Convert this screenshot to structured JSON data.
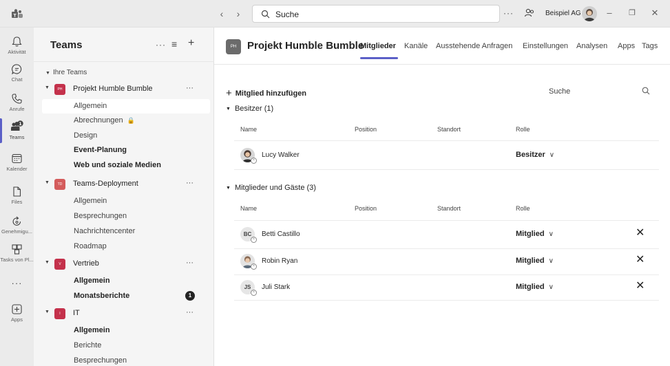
{
  "topbar": {
    "search_text": "Suche",
    "more_label": "···",
    "org_name": "Beispiel AG",
    "minimize": "–",
    "restore": "❐",
    "close": "✕",
    "back": "‹",
    "forward": "›"
  },
  "rail": {
    "items": [
      {
        "label": "Aktivität",
        "icon": "bell-icon"
      },
      {
        "label": "Chat",
        "icon": "chat-icon"
      },
      {
        "label": "Anrufe",
        "icon": "phone-icon"
      },
      {
        "label": "Teams",
        "icon": "teams-icon",
        "badge": "1"
      },
      {
        "label": "Kalender",
        "icon": "calendar-icon"
      },
      {
        "label": "Files",
        "icon": "file-icon"
      },
      {
        "label": "Genehmigu...",
        "icon": "approvals-icon"
      },
      {
        "label": "Tasks von Pl...",
        "icon": "tasks-icon"
      },
      {
        "label": "",
        "icon": "more-icon",
        "glyph": "···"
      },
      {
        "label": "Apps",
        "icon": "apps-icon"
      }
    ],
    "accent": "#5b5fc7"
  },
  "panel": {
    "title": "Teams",
    "more": "···",
    "filter": "≡",
    "add": "+",
    "section_label": "Ihre Teams",
    "teams": [
      {
        "name": "Projekt Humble Bumble",
        "initials": "PH",
        "color": "#c4314b",
        "more": "···",
        "channels": [
          {
            "name": "Allgemein",
            "bold": false,
            "selected": true
          },
          {
            "name": "Abrechnungen",
            "bold": false,
            "locked": true
          },
          {
            "name": "Design",
            "bold": false
          },
          {
            "name": "Event-Planung",
            "bold": true
          },
          {
            "name": "Web und soziale Medien",
            "bold": true
          }
        ]
      },
      {
        "name": "Teams-Deployment",
        "initials": "TD",
        "color": "#d45c5c",
        "more": "···",
        "channels": [
          {
            "name": "Allgemein",
            "bold": false
          },
          {
            "name": "Besprechungen",
            "bold": false
          },
          {
            "name": "Nachrichtencenter",
            "bold": false
          },
          {
            "name": "Roadmap",
            "bold": false
          }
        ]
      },
      {
        "name": "Vertrieb",
        "initials": "V",
        "color": "#c4314b",
        "more": "···",
        "channels": [
          {
            "name": "Allgemein",
            "bold": true
          },
          {
            "name": "Monatsberichte",
            "bold": true,
            "badge": "1"
          }
        ]
      },
      {
        "name": "IT",
        "initials": "I",
        "color": "#c4314b",
        "more": "···",
        "channels": [
          {
            "name": "Allgemein",
            "bold": true
          },
          {
            "name": "Berichte",
            "bold": false
          },
          {
            "name": "Besprechungen",
            "bold": false
          }
        ]
      }
    ]
  },
  "main": {
    "team_initials": "PH",
    "team_name": "Projekt Humble Bumble",
    "tabs": [
      "Mitglieder",
      "Kanäle",
      "Ausstehende Anfragen",
      "Einstellungen",
      "Analysen",
      "Apps",
      "Tags"
    ],
    "active_tab": "Mitglieder",
    "add_member": "Mitglied hinzufügen",
    "search_label": "Suche",
    "columns": {
      "name": "Name",
      "position": "Position",
      "location": "Standort",
      "role": "Rolle"
    },
    "owners": {
      "header": "Besitzer (1)",
      "members": [
        {
          "name": "Lucy Walker",
          "role": "Besitzer",
          "avatar": "photo"
        }
      ]
    },
    "guests": {
      "header": "Mitglieder und Gäste (3)",
      "members": [
        {
          "name": "Betti Castillo",
          "role": "Mitglied",
          "initials": "BC",
          "avatar": "initials"
        },
        {
          "name": "Robin Ryan",
          "role": "Mitglied",
          "avatar": "photo"
        },
        {
          "name": "Juli Stark",
          "role": "Mitglied",
          "initials": "JS",
          "avatar": "initials"
        }
      ]
    },
    "remove_glyph": "✕",
    "chevron_glyph": "∨"
  }
}
